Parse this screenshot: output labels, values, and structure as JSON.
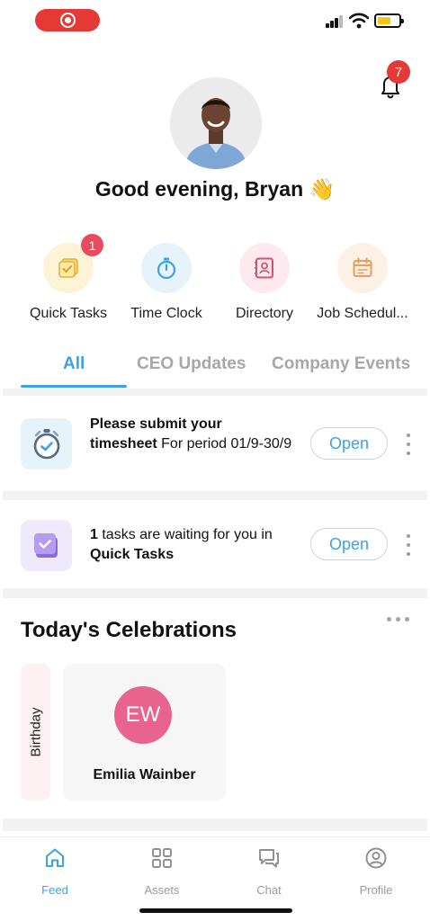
{
  "status_bar": {
    "recording_indicator": "screen-recording",
    "battery_color": "#f5c518"
  },
  "header": {
    "notification_count": "7",
    "greeting": "Good evening, Bryan 👋"
  },
  "quick_actions": [
    {
      "label": "Quick Tasks",
      "icon": "quick-tasks-icon",
      "badge": "1"
    },
    {
      "label": "Time Clock",
      "icon": "stopwatch-icon"
    },
    {
      "label": "Directory",
      "icon": "contact-book-icon"
    },
    {
      "label": "Job Schedul...",
      "icon": "calendar-icon"
    }
  ],
  "tabs": [
    {
      "label": "All",
      "active": true
    },
    {
      "label": "CEO Updates",
      "active": false
    },
    {
      "label": "Company Events",
      "active": false
    }
  ],
  "feed": [
    {
      "icon": "stopwatch-icon",
      "text_bold": "Please submit your timesheet",
      "text_rest": " For period 01/9-30/9",
      "button": "Open"
    },
    {
      "icon": "quick-tasks-icon",
      "text_bold_count": "1",
      "text_mid": " tasks are waiting for you in ",
      "text_bold_target": "Quick Tasks",
      "button": "Open"
    }
  ],
  "celebrations": {
    "title": "Today's Celebrations",
    "category": "Birthday",
    "person": {
      "initials": "EW",
      "name": "Emilia Wainber"
    }
  },
  "bottom_nav": [
    {
      "label": "Feed",
      "icon": "home-icon",
      "active": true
    },
    {
      "label": "Assets",
      "icon": "grid-icon",
      "active": false
    },
    {
      "label": "Chat",
      "icon": "chat-icon",
      "active": false
    },
    {
      "label": "Profile",
      "icon": "profile-icon",
      "active": false
    }
  ],
  "colors": {
    "accent": "#3ba3e3",
    "badge_red": "#e53935",
    "avatar_pink": "#e8648e"
  }
}
